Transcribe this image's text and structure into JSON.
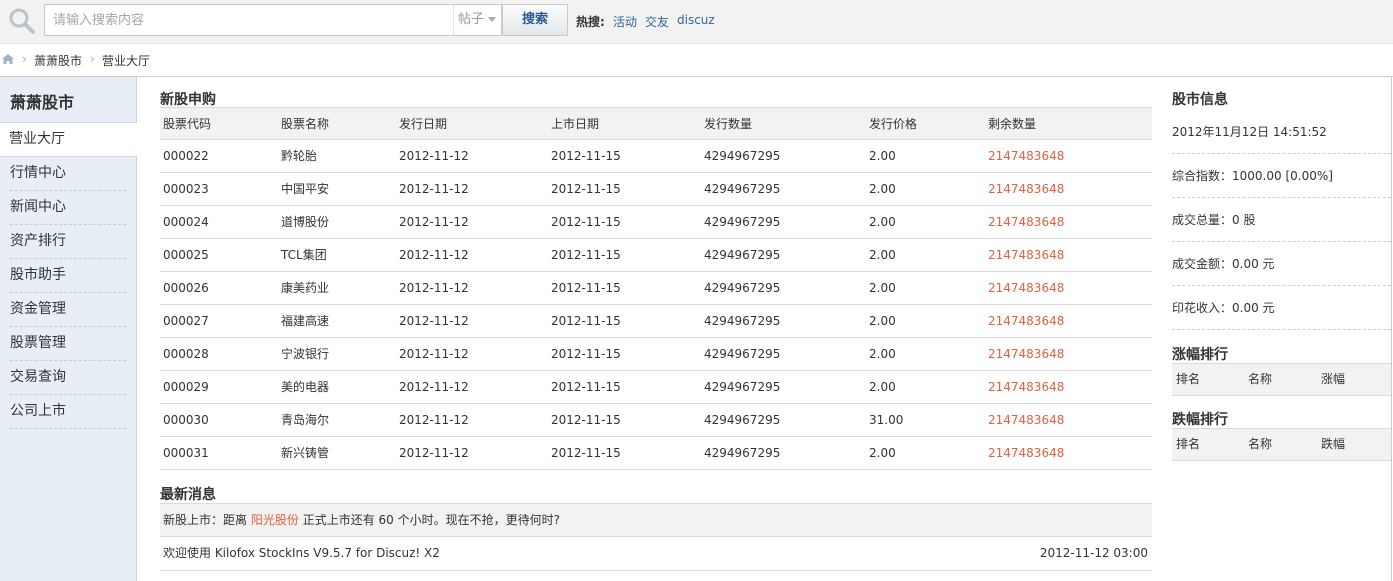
{
  "search": {
    "placeholder": "请输入搜索内容",
    "scope": "帖子",
    "button": "搜索",
    "hot_label": "热搜:",
    "hot_links": [
      "活动",
      "交友",
      "discuz"
    ]
  },
  "breadcrumb": [
    "萧萧股市",
    "营业大厅"
  ],
  "sidebar": {
    "title": "萧萧股市",
    "active": "营业大厅",
    "items": [
      "行情中心",
      "新闻中心",
      "资产排行",
      "股市助手",
      "资金管理",
      "股票管理",
      "交易查询",
      "公司上市"
    ]
  },
  "ipo": {
    "title": "新股申购",
    "columns": [
      "股票代码",
      "股票名称",
      "发行日期",
      "上市日期",
      "发行数量",
      "发行价格",
      "剩余数量"
    ],
    "rows": [
      [
        "000022",
        "黔轮胎",
        "2012-11-12",
        "2012-11-15",
        "4294967295",
        "2.00",
        "2147483648"
      ],
      [
        "000023",
        "中国平安",
        "2012-11-12",
        "2012-11-15",
        "4294967295",
        "2.00",
        "2147483648"
      ],
      [
        "000024",
        "道博股份",
        "2012-11-12",
        "2012-11-15",
        "4294967295",
        "2.00",
        "2147483648"
      ],
      [
        "000025",
        "TCL集团",
        "2012-11-12",
        "2012-11-15",
        "4294967295",
        "2.00",
        "2147483648"
      ],
      [
        "000026",
        "康美药业",
        "2012-11-12",
        "2012-11-15",
        "4294967295",
        "2.00",
        "2147483648"
      ],
      [
        "000027",
        "福建高速",
        "2012-11-12",
        "2012-11-15",
        "4294967295",
        "2.00",
        "2147483648"
      ],
      [
        "000028",
        "宁波银行",
        "2012-11-12",
        "2012-11-15",
        "4294967295",
        "2.00",
        "2147483648"
      ],
      [
        "000029",
        "美的电器",
        "2012-11-12",
        "2012-11-15",
        "4294967295",
        "2.00",
        "2147483648"
      ],
      [
        "000030",
        "青岛海尔",
        "2012-11-12",
        "2012-11-15",
        "4294967295",
        "31.00",
        "2147483648"
      ],
      [
        "000031",
        "新兴铸管",
        "2012-11-12",
        "2012-11-15",
        "4294967295",
        "2.00",
        "2147483648"
      ]
    ]
  },
  "news": {
    "title": "最新消息",
    "highlight_prefix": "新股上市：距离",
    "highlight_stock": "阳光股份",
    "highlight_suffix": "正式上市还有 60 个小时。现在不抢，更待何时?",
    "message": "欢迎使用 Kilofox StockIns V9.5.7 for Discuz! X2",
    "message_time": "2012-11-12 03:00"
  },
  "market": {
    "title": "股市信息",
    "datetime": "2012年11月12日 14:51:52",
    "index": "综合指数：1000.00 [0.00%]",
    "volume": "成交总量：0 股",
    "amount": "成交金额：0.00 元",
    "stamp": "印花收入：0.00 元"
  },
  "gainers": {
    "title": "涨幅排行",
    "columns": [
      "排名",
      "名称",
      "涨幅"
    ]
  },
  "losers": {
    "title": "跌幅排行",
    "columns": [
      "排名",
      "名称",
      "跌幅"
    ]
  },
  "colors": {
    "accent_red": "#e06040",
    "link_blue": "#336699",
    "sidebar_bg": "#e8eef5"
  }
}
